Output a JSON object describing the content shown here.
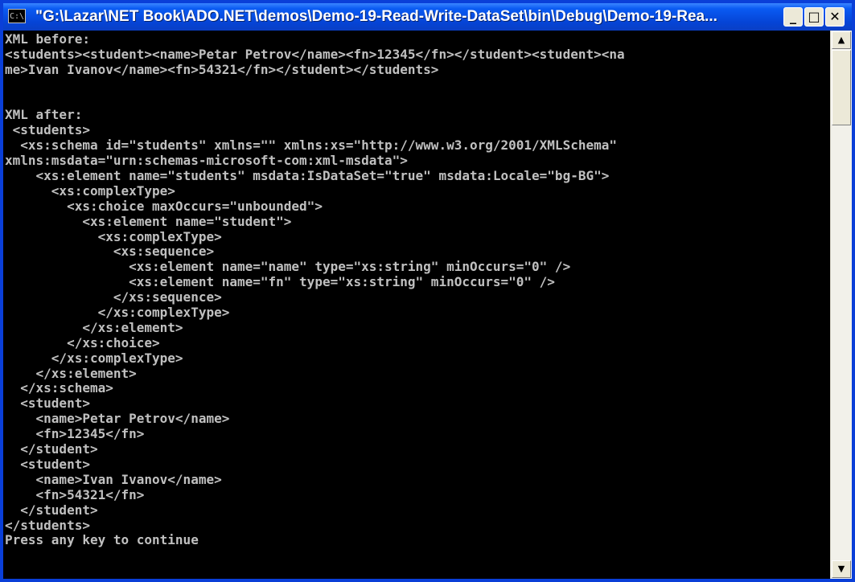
{
  "window": {
    "title": "\"G:\\Lazar\\NET Book\\ADO.NET\\demos\\Demo-19-Read-Write-DataSet\\bin\\Debug\\Demo-19-Rea...",
    "icon": "console-icon",
    "icon_glyph": "C:\\",
    "minimize_glyph": "_",
    "maximize_glyph": "□",
    "close_glyph": "✕"
  },
  "scrollbar": {
    "up_glyph": "▲",
    "down_glyph": "▼"
  },
  "console": {
    "lines": [
      "XML before:",
      "<students><student><name>Petar Petrov</name><fn>12345</fn></student><student><na",
      "me>Ivan Ivanov</name><fn>54321</fn></student></students>",
      "",
      "",
      "XML after:",
      " <students>",
      "  <xs:schema id=\"students\" xmlns=\"\" xmlns:xs=\"http://www.w3.org/2001/XMLSchema\"",
      "xmlns:msdata=\"urn:schemas-microsoft-com:xml-msdata\">",
      "    <xs:element name=\"students\" msdata:IsDataSet=\"true\" msdata:Locale=\"bg-BG\">",
      "      <xs:complexType>",
      "        <xs:choice maxOccurs=\"unbounded\">",
      "          <xs:element name=\"student\">",
      "            <xs:complexType>",
      "              <xs:sequence>",
      "                <xs:element name=\"name\" type=\"xs:string\" minOccurs=\"0\" />",
      "                <xs:element name=\"fn\" type=\"xs:string\" minOccurs=\"0\" />",
      "              </xs:sequence>",
      "            </xs:complexType>",
      "          </xs:element>",
      "        </xs:choice>",
      "      </xs:complexType>",
      "    </xs:element>",
      "  </xs:schema>",
      "  <student>",
      "    <name>Petar Petrov</name>",
      "    <fn>12345</fn>",
      "  </student>",
      "  <student>",
      "    <name>Ivan Ivanov</name>",
      "    <fn>54321</fn>",
      "  </student>",
      "</students>",
      "Press any key to continue"
    ]
  }
}
